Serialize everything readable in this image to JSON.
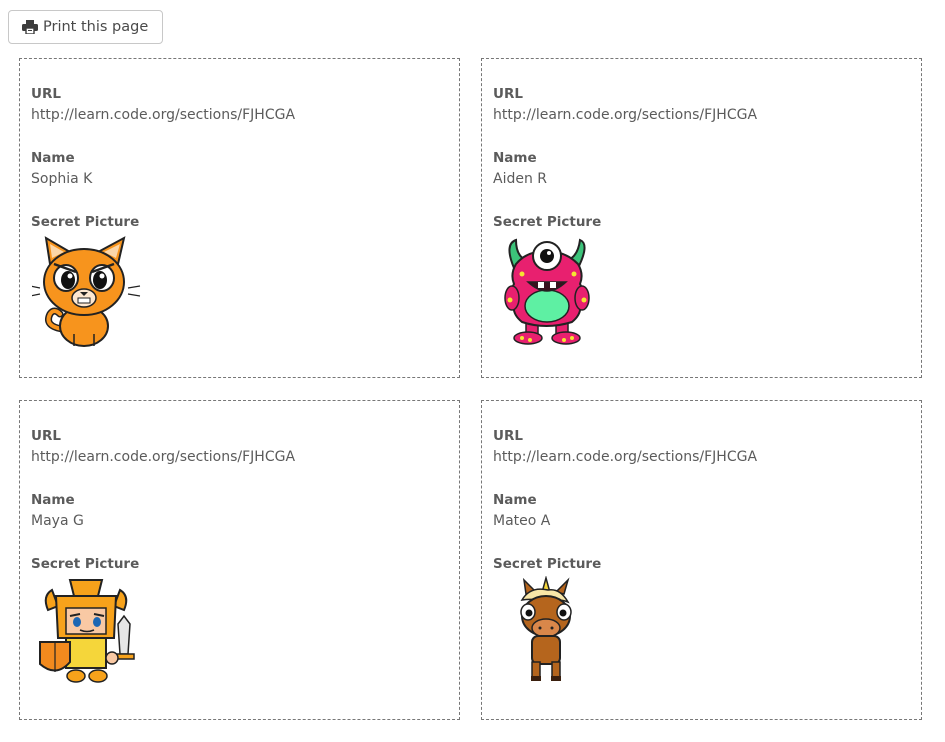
{
  "toolbar": {
    "print_label": "Print this page",
    "print_icon": "printer-icon"
  },
  "labels": {
    "url": "URL",
    "name": "Name",
    "secret_picture": "Secret Picture"
  },
  "cards": [
    {
      "url": "http://learn.code.org/sections/FJHCGA",
      "name": "Sophia K",
      "picture": "cat-icon"
    },
    {
      "url": "http://learn.code.org/sections/FJHCGA",
      "name": "Aiden R",
      "picture": "monster-icon"
    },
    {
      "url": "http://learn.code.org/sections/FJHCGA",
      "name": "Maya G",
      "picture": "knight-icon"
    },
    {
      "url": "http://learn.code.org/sections/FJHCGA",
      "name": "Mateo A",
      "picture": "unicorn-icon"
    }
  ]
}
